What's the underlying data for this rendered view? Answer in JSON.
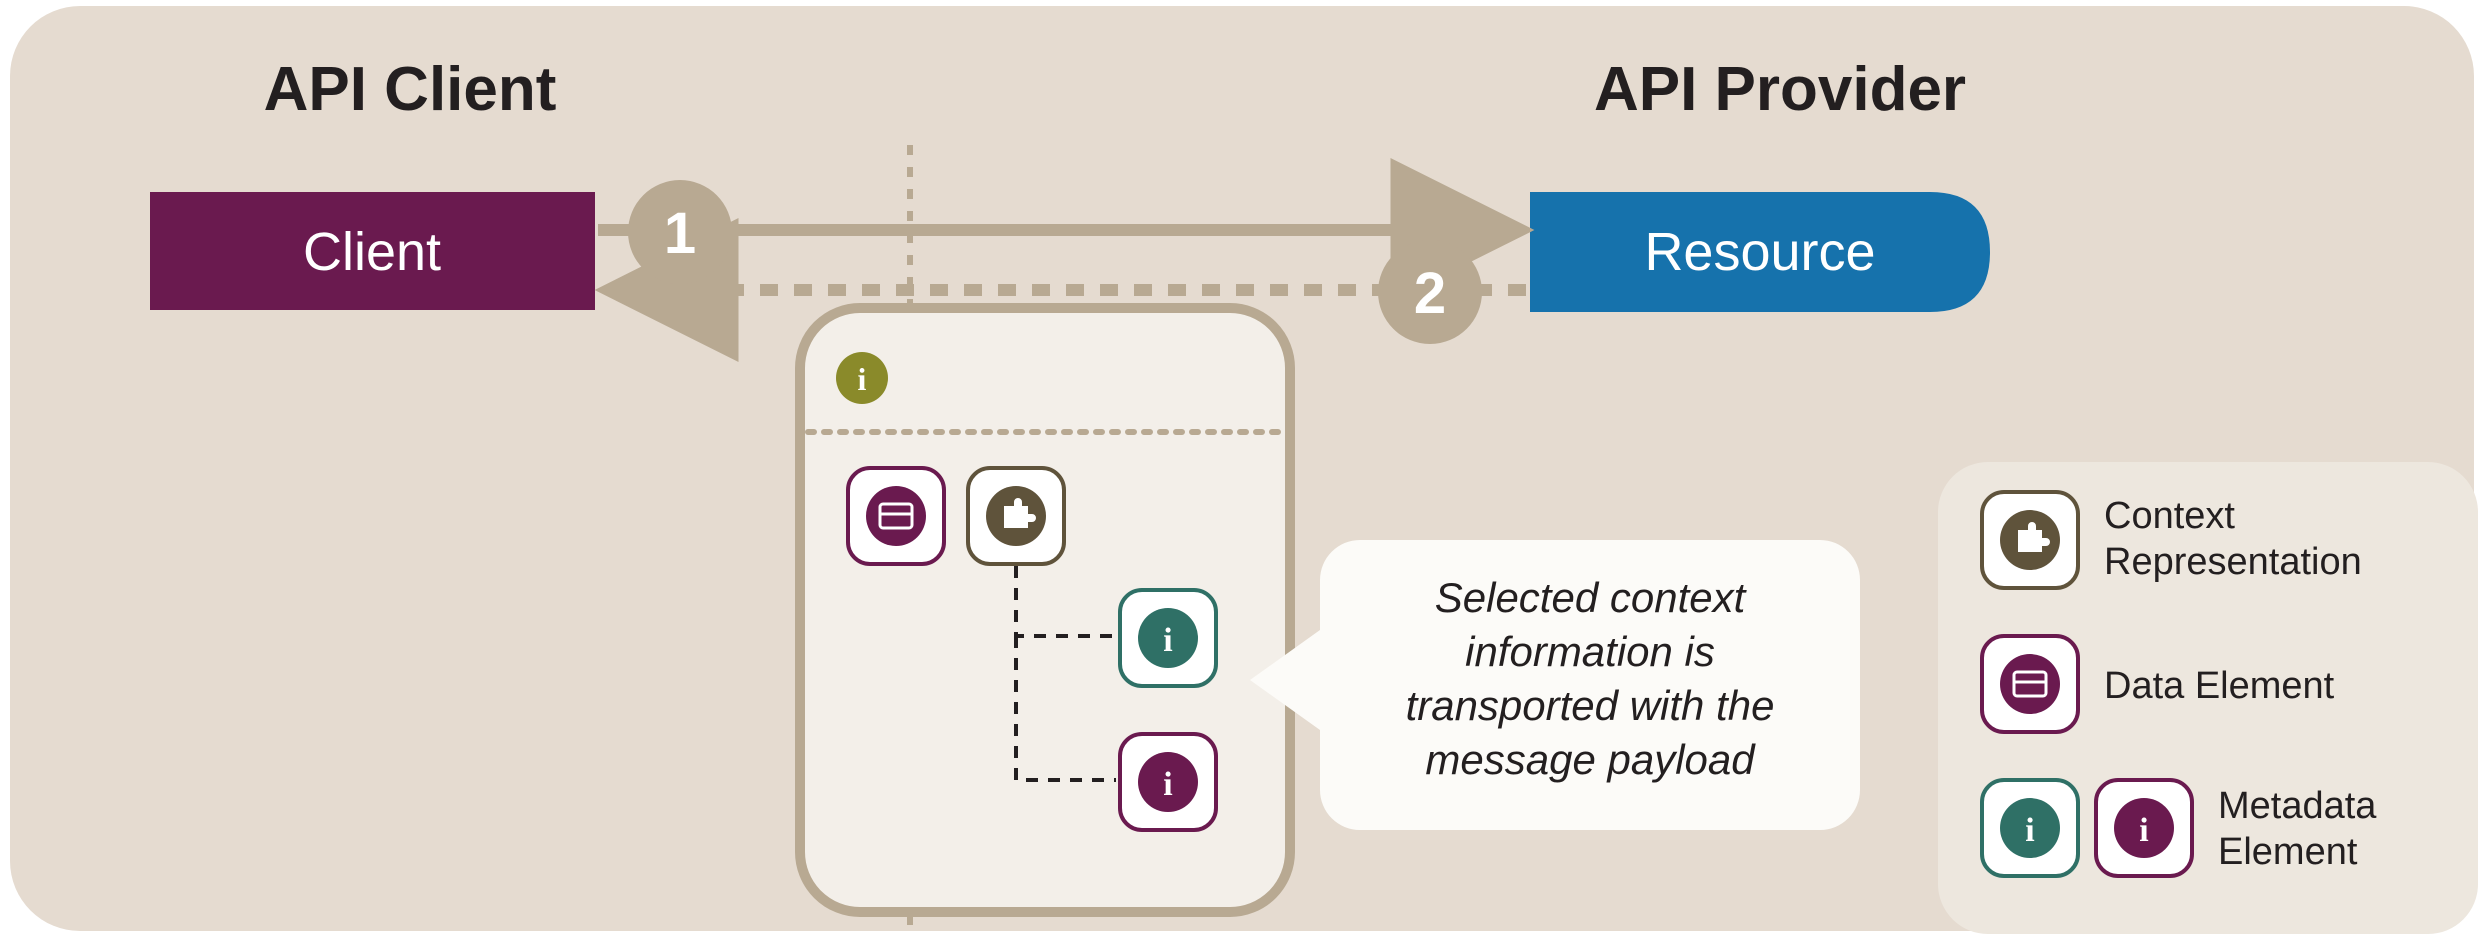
{
  "titles": {
    "client": "API Client",
    "provider": "API Provider"
  },
  "nodes": {
    "client": "Client",
    "resource": "Resource"
  },
  "steps": {
    "step1": "1",
    "step2": "2"
  },
  "callout": {
    "line1": "Selected context",
    "line2": "information is",
    "line3": "transported with the",
    "line4": "message payload"
  },
  "legend": {
    "context_rep_line1": "Context",
    "context_rep_line2": "Representation",
    "data_element": "Data Element",
    "metadata_line1": "Metadata",
    "metadata_line2": "Element"
  },
  "colors": {
    "bg": "#e5dbd0",
    "taupe": "#b8a992",
    "purple": "#6a1a4f",
    "blue": "#1672ac",
    "olive": "#8a8a2a",
    "teal": "#2f7066",
    "maroon": "#6a1a4f",
    "brown_dark": "#5f533b",
    "panel_light": "#f3efe9",
    "legend_bg": "#ede7de",
    "text_dark": "#231f20",
    "white": "#ffffff"
  }
}
